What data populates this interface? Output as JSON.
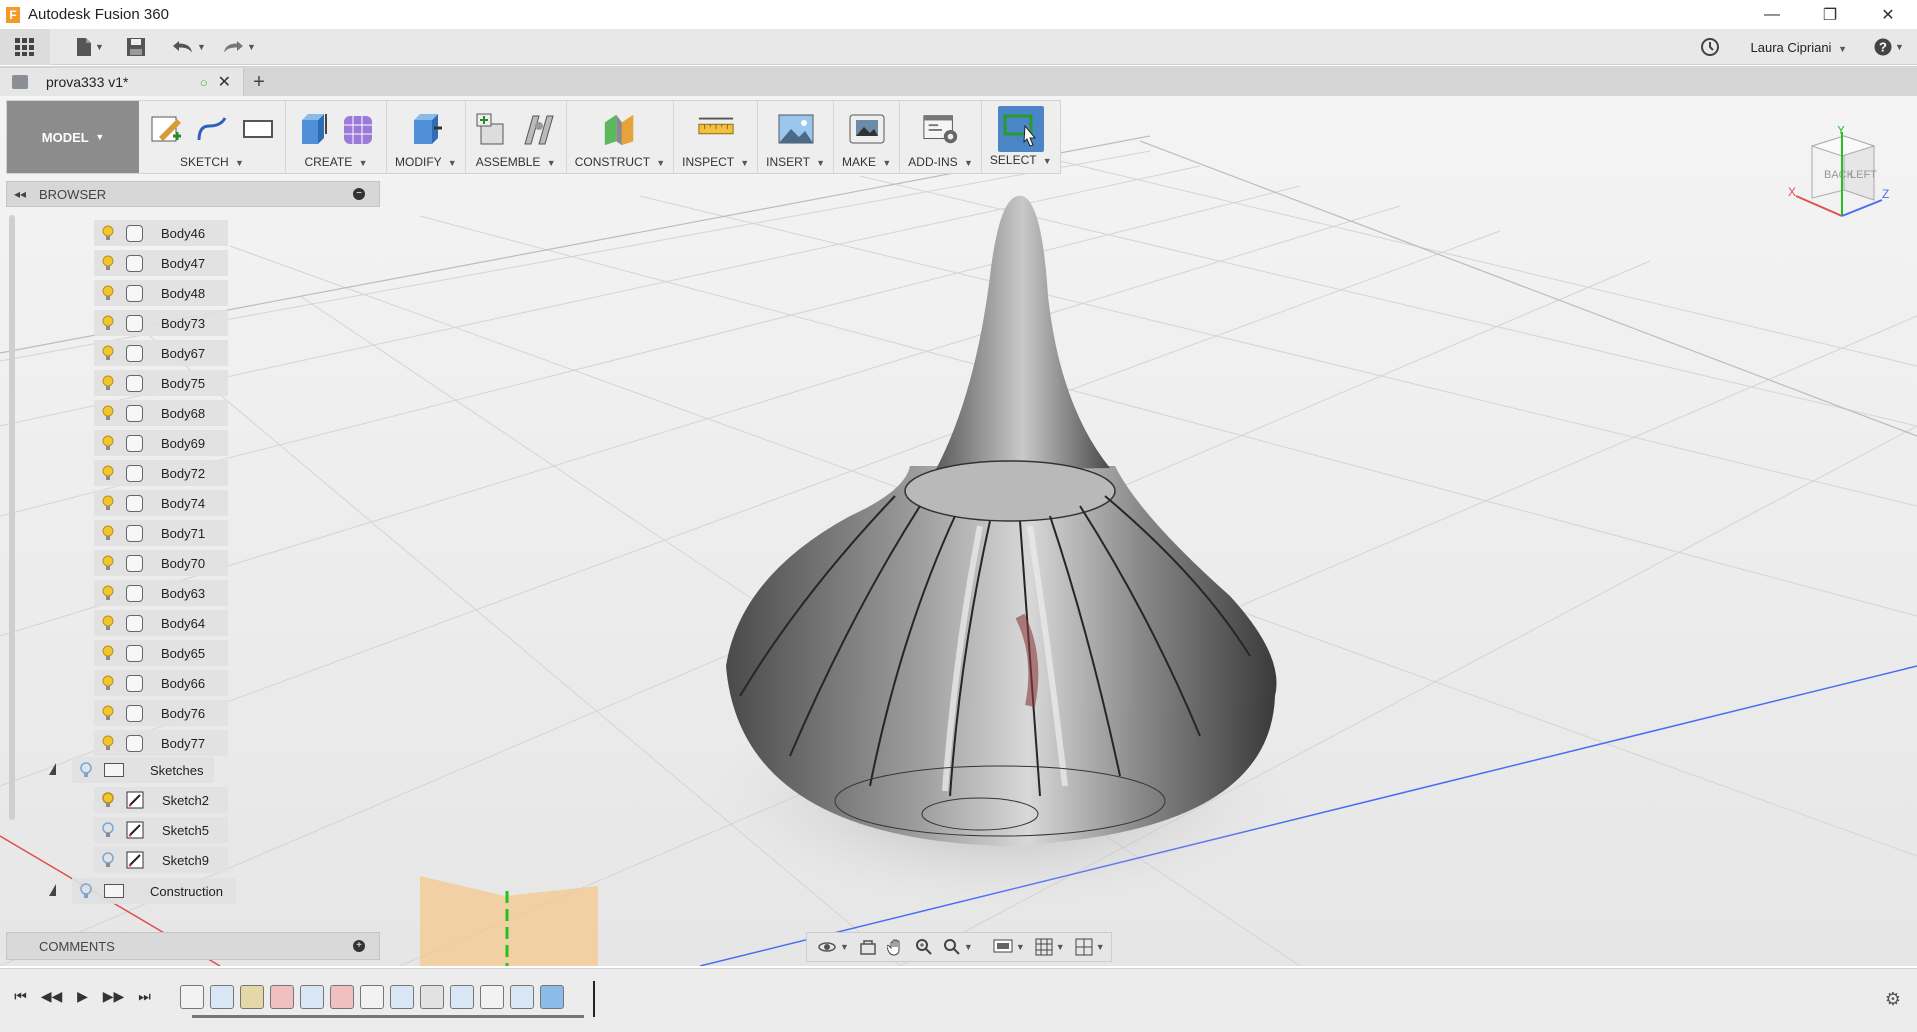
{
  "window": {
    "title": "Autodesk Fusion 360",
    "logo_letter": "F",
    "controls": {
      "minimize": "—",
      "restore": "❐",
      "close": "✕"
    }
  },
  "quick_access": {
    "user": "Laura Cipriani",
    "icons": [
      "grid-menu-icon",
      "file-icon",
      "save-icon",
      "undo-icon",
      "redo-icon",
      "history-icon",
      "help-icon"
    ]
  },
  "document_tab": {
    "title": "prova333 v1*",
    "add": "+"
  },
  "toolbar": {
    "workspace": "MODEL",
    "groups": [
      {
        "label": "SKETCH"
      },
      {
        "label": "CREATE"
      },
      {
        "label": "MODIFY"
      },
      {
        "label": "ASSEMBLE"
      },
      {
        "label": "CONSTRUCT"
      },
      {
        "label": "INSPECT"
      },
      {
        "label": "INSERT"
      },
      {
        "label": "MAKE"
      },
      {
        "label": "ADD-INS"
      },
      {
        "label": "SELECT"
      }
    ]
  },
  "browser": {
    "title": "BROWSER",
    "bodies": [
      "Body46",
      "Body47",
      "Body48",
      "Body73",
      "Body67",
      "Body75",
      "Body68",
      "Body69",
      "Body72",
      "Body74",
      "Body71",
      "Body70",
      "Body63",
      "Body64",
      "Body65",
      "Body66",
      "Body76",
      "Body77"
    ],
    "sketches_folder": "Sketches",
    "sketches": [
      "Sketch2",
      "Sketch5",
      "Sketch9"
    ],
    "construction_folder": "Construction"
  },
  "comments": {
    "title": "COMMENTS"
  },
  "viewcube": {
    "faces": [
      "BACK",
      "LEFT"
    ],
    "axes": [
      "X",
      "Y",
      "Z"
    ]
  },
  "colors": {
    "workspace_bg": "#8c8c8c",
    "select_active": "#4a86c5",
    "bulb": "#f2c62e",
    "axis_red": "#e05050",
    "axis_green": "#21c321",
    "axis_blue": "#4a6cf2",
    "plane_orange": "#f4c98c"
  }
}
